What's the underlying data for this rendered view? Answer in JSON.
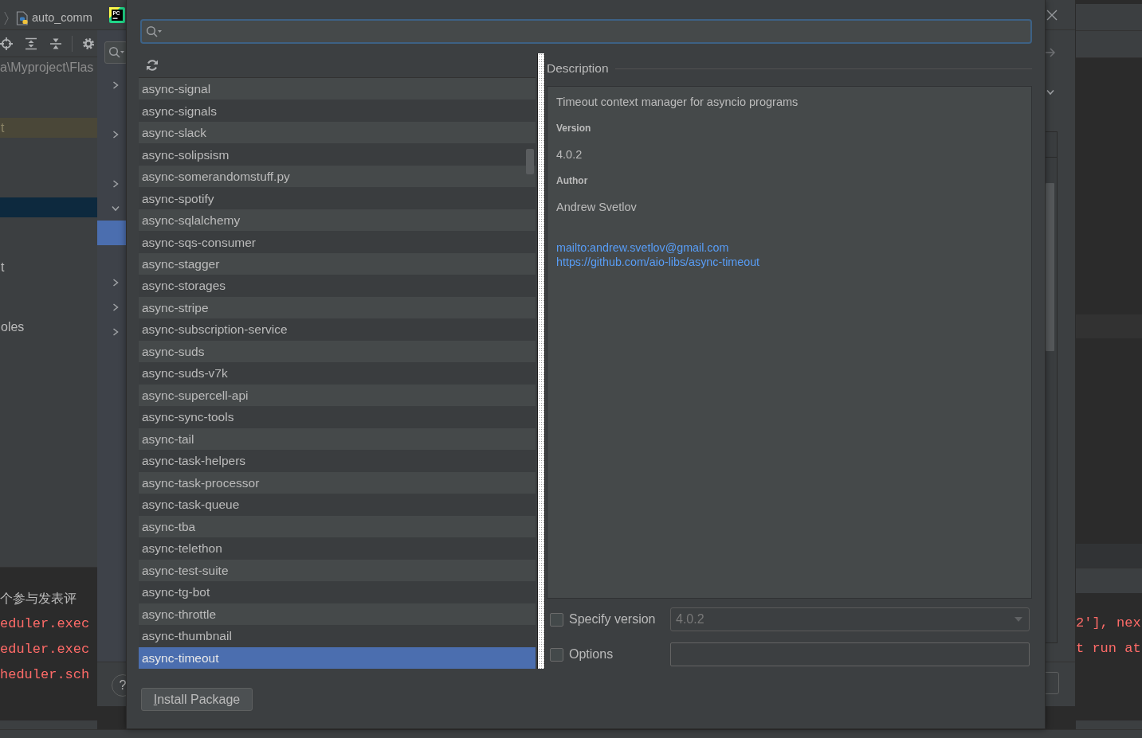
{
  "ide": {
    "breadcrumb": {
      "file": "auto_comm"
    },
    "project_path": "a\\Myproject\\Flas",
    "tree": [
      {
        "selected": false,
        "highlighted": false
      },
      {
        "selected": false,
        "highlighted": false
      },
      {
        "label": "t",
        "selected": false,
        "highlighted": true
      },
      {
        "selected": false,
        "highlighted": false
      },
      {
        "selected": false,
        "highlighted": false
      },
      {
        "selected": false,
        "highlighted": false
      },
      {
        "selected": true,
        "highlighted": false
      },
      {
        "selected": false,
        "highlighted": false
      },
      {
        "selected": false,
        "highlighted": false
      },
      {
        "label": "t",
        "selected": false,
        "highlighted": false
      },
      {
        "selected": false,
        "highlighted": false
      },
      {
        "selected": false,
        "highlighted": false
      },
      {
        "label": "oles",
        "selected": false,
        "highlighted": false
      }
    ],
    "console_left": [
      {
        "kind": "output",
        "text": "个参与发表评"
      },
      {
        "kind": "error",
        "text": "eduler.exec"
      },
      {
        "kind": "error",
        "text": "eduler.exec"
      },
      {
        "kind": "error",
        "text": "heduler.sch"
      }
    ],
    "console_right": [
      {
        "kind": "error",
        "text": "2'], nex"
      },
      {
        "kind": "error",
        "text": "t run at"
      }
    ]
  },
  "settings_dialog": {
    "logo": "PC",
    "tree": [
      {
        "expanded": false,
        "selected": false
      },
      {
        "selected": false
      },
      {
        "expanded": false,
        "selected": false
      },
      {
        "selected": false
      },
      {
        "expanded": false,
        "selected": false
      },
      {
        "expanded": true,
        "selected": false
      },
      {
        "selected": true
      },
      {
        "selected": false
      },
      {
        "expanded": false,
        "selected": false
      },
      {
        "expanded": false,
        "selected": false
      },
      {
        "expanded": false,
        "selected": false
      }
    ],
    "help": "?"
  },
  "packages_dialog": {
    "packages": [
      {
        "name": "async-signal",
        "selected": false
      },
      {
        "name": "async-signals",
        "selected": false
      },
      {
        "name": "async-slack",
        "selected": false
      },
      {
        "name": "async-solipsism",
        "selected": false
      },
      {
        "name": "async-somerandomstuff.py",
        "selected": false
      },
      {
        "name": "async-spotify",
        "selected": false
      },
      {
        "name": "async-sqlalchemy",
        "selected": false
      },
      {
        "name": "async-sqs-consumer",
        "selected": false
      },
      {
        "name": "async-stagger",
        "selected": false
      },
      {
        "name": "async-storages",
        "selected": false
      },
      {
        "name": "async-stripe",
        "selected": false
      },
      {
        "name": "async-subscription-service",
        "selected": false
      },
      {
        "name": "async-suds",
        "selected": false
      },
      {
        "name": "async-suds-v7k",
        "selected": false
      },
      {
        "name": "async-supercell-api",
        "selected": false
      },
      {
        "name": "async-sync-tools",
        "selected": false
      },
      {
        "name": "async-tail",
        "selected": false
      },
      {
        "name": "async-task-helpers",
        "selected": false
      },
      {
        "name": "async-task-processor",
        "selected": false
      },
      {
        "name": "async-task-queue",
        "selected": false
      },
      {
        "name": "async-tba",
        "selected": false
      },
      {
        "name": "async-telethon",
        "selected": false
      },
      {
        "name": "async-test-suite",
        "selected": false
      },
      {
        "name": "async-tg-bot",
        "selected": false
      },
      {
        "name": "async-throttle",
        "selected": false
      },
      {
        "name": "async-thumbnail",
        "selected": false
      },
      {
        "name": "async-timeout",
        "selected": true
      }
    ],
    "description": {
      "heading": "Description",
      "summary": "Timeout context manager for asyncio programs",
      "fields": [
        {
          "label": "Version",
          "value": "4.0.2"
        },
        {
          "label": "Author",
          "value": "Andrew Svetlov"
        }
      ],
      "links": [
        "mailto:andrew.svetlov@gmail.com",
        "https://github.com/aio-libs/async-timeout"
      ]
    },
    "specify_version": {
      "label": "Specify version",
      "checked": false,
      "value": "4.0.2",
      "disabled": true
    },
    "options": {
      "label": "Options",
      "checked": false
    },
    "install_button": "Install Package"
  }
}
